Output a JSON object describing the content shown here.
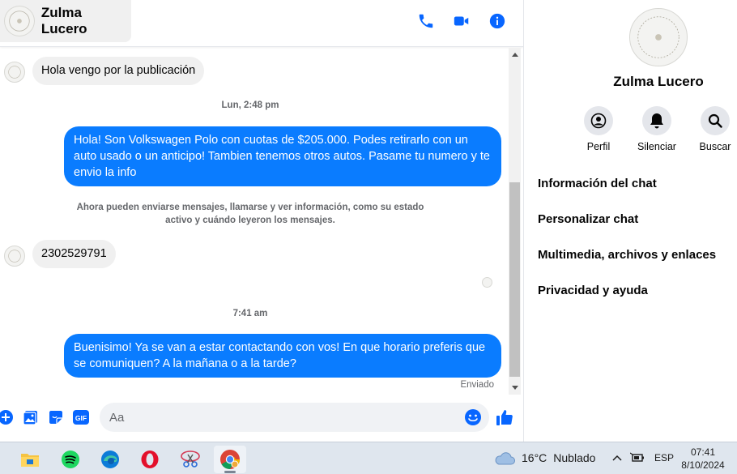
{
  "contact": {
    "name": "Zulma Lucero"
  },
  "header_icons": [
    "phone-icon",
    "video-camera-icon",
    "info-icon"
  ],
  "messages": [
    {
      "direction": "in",
      "text": "Hola vengo por la publicación"
    },
    {
      "type": "timestamp",
      "text": "Lun, 2:48 pm"
    },
    {
      "direction": "out",
      "text": "Hola! Son Volkswagen Polo con cuotas de $205.000. Podes retirarlo con un auto usado o un anticipo! Tambien tenemos otros autos. Pasame tu numero y te envio la info"
    },
    {
      "type": "notice",
      "text": "Ahora pueden enviarse mensajes, llamarse y ver información, como su estado activo y cuándo leyeron los mensajes."
    },
    {
      "direction": "in",
      "text": "2302529791"
    },
    {
      "type": "timestamp",
      "text": "7:41 am"
    },
    {
      "direction": "out",
      "text": "Buenisimo! Ya se van a estar contactando con vos! En que horario preferis que se comuniquen? A la mañana o a la tarde?"
    }
  ],
  "sent_status": "Enviado",
  "composer": {
    "placeholder": "Aa",
    "icons": [
      "plus-icon",
      "photo-icon",
      "sticker-icon",
      "gif-icon",
      "emoji-icon",
      "thumbs-up-icon"
    ],
    "gif_label": "GIF"
  },
  "side_panel": {
    "name": "Zulma Lucero",
    "actions": [
      {
        "label": "Perfil",
        "icon": "profile-icon"
      },
      {
        "label": "Silenciar",
        "icon": "bell-icon"
      },
      {
        "label": "Buscar",
        "icon": "search-icon"
      }
    ],
    "menu": [
      "Información del chat",
      "Personalizar chat",
      "Multimedia, archivos y enlaces",
      "Privacidad y ayuda"
    ]
  },
  "taskbar": {
    "apps": [
      "file-explorer-icon",
      "spotify-icon",
      "edge-icon",
      "opera-icon",
      "snipping-tool-icon",
      "chrome-icon"
    ],
    "weather": {
      "temp": "16°C",
      "desc": "Nublado"
    },
    "language": "ESP",
    "time": "07:41",
    "date": "8/10/2024"
  },
  "colors": {
    "accent": "#0a7cff",
    "bubble_in": "#f0f0f0",
    "icon_blue": "#0866ff"
  }
}
